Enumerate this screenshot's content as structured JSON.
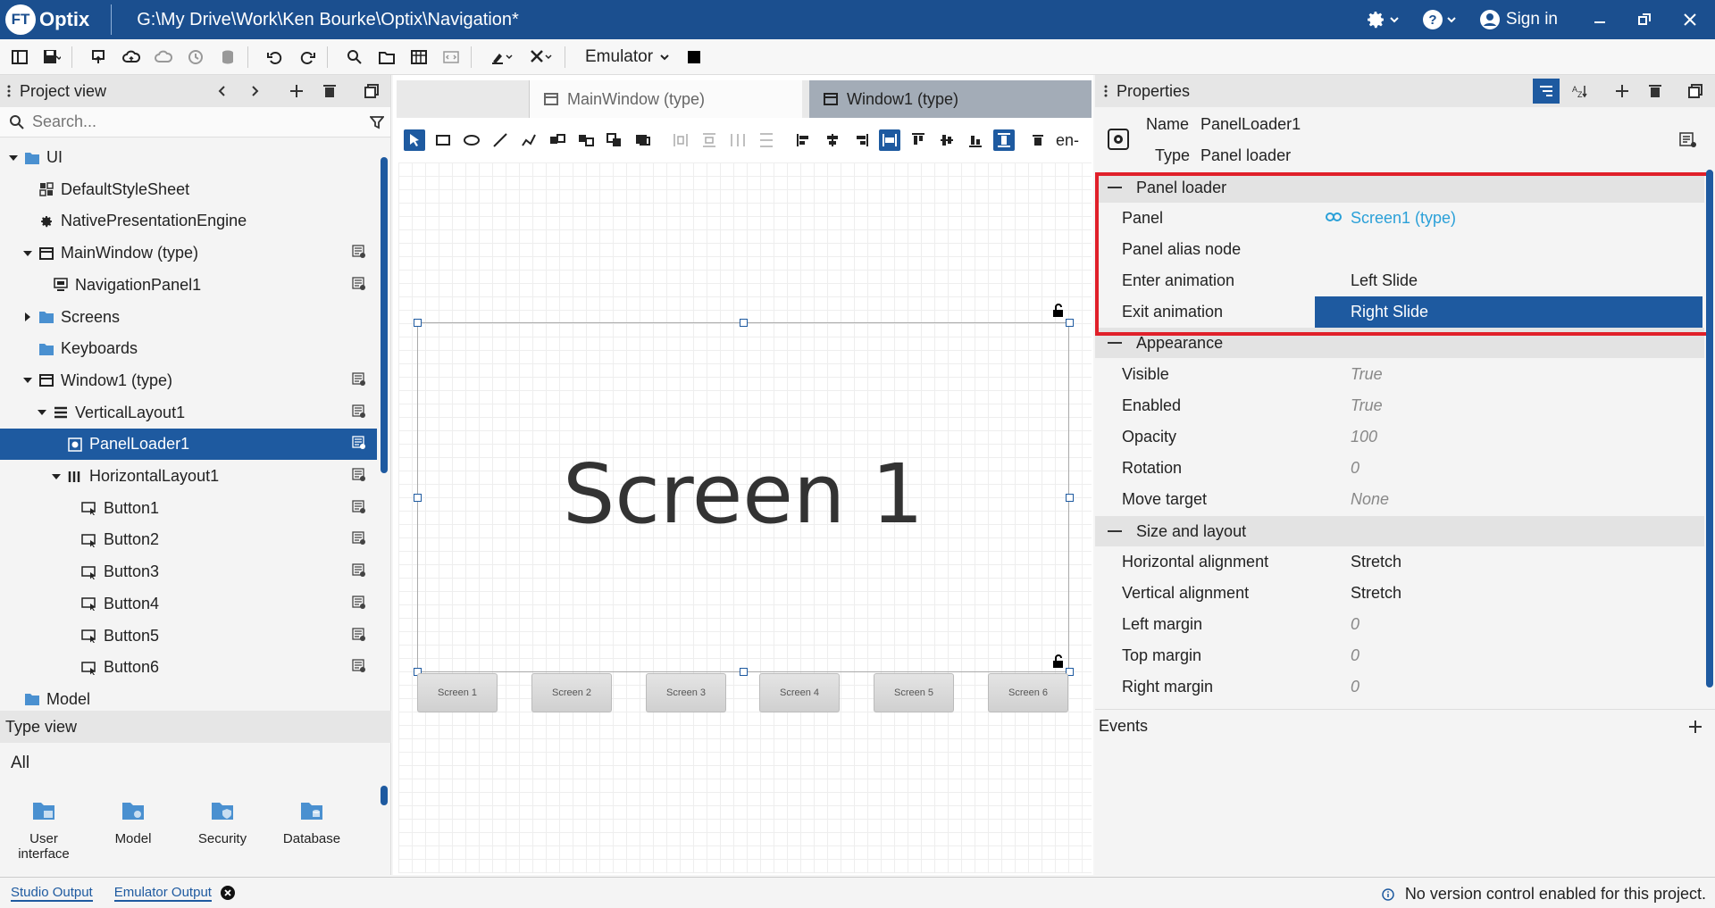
{
  "app": {
    "logo_prefix": "FT",
    "logo_name": "Optix",
    "window_title": "G:\\My Drive\\Work\\Ken Bourke\\Optix\\Navigation*",
    "sign_in": "Sign in"
  },
  "toolbar": {
    "emulator_label": "Emulator"
  },
  "project_view": {
    "title": "Project view",
    "search_placeholder": "Search...",
    "tree": [
      {
        "label": "UI",
        "icon": "folder-icon"
      },
      {
        "label": "DefaultStyleSheet",
        "icon": "stylesheet-icon"
      },
      {
        "label": "NativePresentationEngine",
        "icon": "gear-icon"
      },
      {
        "label": "MainWindow (type)",
        "icon": "window-icon"
      },
      {
        "label": "NavigationPanel1",
        "icon": "navigation-panel-icon"
      },
      {
        "label": "Screens",
        "icon": "folder-icon"
      },
      {
        "label": "Keyboards",
        "icon": "folder-icon"
      },
      {
        "label": "Window1 (type)",
        "icon": "window-icon"
      },
      {
        "label": "VerticalLayout1",
        "icon": "vertical-layout-icon"
      },
      {
        "label": "PanelLoader1",
        "icon": "panel-loader-icon"
      },
      {
        "label": "HorizontalLayout1",
        "icon": "horizontal-layout-icon"
      },
      {
        "label": "Button1",
        "icon": "button-icon"
      },
      {
        "label": "Button2",
        "icon": "button-icon"
      },
      {
        "label": "Button3",
        "icon": "button-icon"
      },
      {
        "label": "Button4",
        "icon": "button-icon"
      },
      {
        "label": "Button5",
        "icon": "button-icon"
      },
      {
        "label": "Button6",
        "icon": "button-icon"
      },
      {
        "label": "Model",
        "icon": "folder-icon"
      }
    ]
  },
  "type_view": {
    "title": "Type view",
    "filter": "All",
    "items": [
      {
        "label": "User interface"
      },
      {
        "label": "Model"
      },
      {
        "label": "Security"
      },
      {
        "label": "Database"
      }
    ]
  },
  "editor": {
    "tabs": [
      {
        "label": "MainWindow (type)"
      },
      {
        "label": "Window1 (type)"
      }
    ],
    "locale": "en-",
    "screen_text": "Screen 1",
    "nav_buttons": [
      "Screen 1",
      "Screen 2",
      "Screen 3",
      "Screen 4",
      "Screen 5",
      "Screen 6"
    ]
  },
  "properties": {
    "title": "Properties",
    "name_label": "Name",
    "name_value": "PanelLoader1",
    "type_label": "Type",
    "type_value": "Panel loader",
    "sections": {
      "panel_loader": "Panel loader",
      "appearance": "Appearance",
      "size_layout": "Size and layout"
    },
    "panel_loader": [
      {
        "label": "Panel",
        "value": "Screen1 (type)"
      },
      {
        "label": "Panel alias node",
        "value": ""
      },
      {
        "label": "Enter animation",
        "value": "Left Slide"
      },
      {
        "label": "Exit animation",
        "value": "Right Slide"
      }
    ],
    "appearance": [
      {
        "label": "Visible",
        "value": "True"
      },
      {
        "label": "Enabled",
        "value": "True"
      },
      {
        "label": "Opacity",
        "value": "100"
      },
      {
        "label": "Rotation",
        "value": "0"
      },
      {
        "label": "Move target",
        "value": "None"
      }
    ],
    "size_layout": [
      {
        "label": "Horizontal alignment",
        "value": "Stretch"
      },
      {
        "label": "Vertical alignment",
        "value": "Stretch"
      },
      {
        "label": "Left margin",
        "value": "0"
      },
      {
        "label": "Top margin",
        "value": "0"
      },
      {
        "label": "Right margin",
        "value": "0"
      }
    ],
    "events_label": "Events"
  },
  "status": {
    "tabs": [
      "Studio Output",
      "Emulator Output"
    ],
    "message": "No version control enabled for this project."
  },
  "colors": {
    "brand": "#1b4f8f",
    "selection": "#1e5aa0",
    "highlight": "#e0202a",
    "link": "#2aa0d8"
  }
}
